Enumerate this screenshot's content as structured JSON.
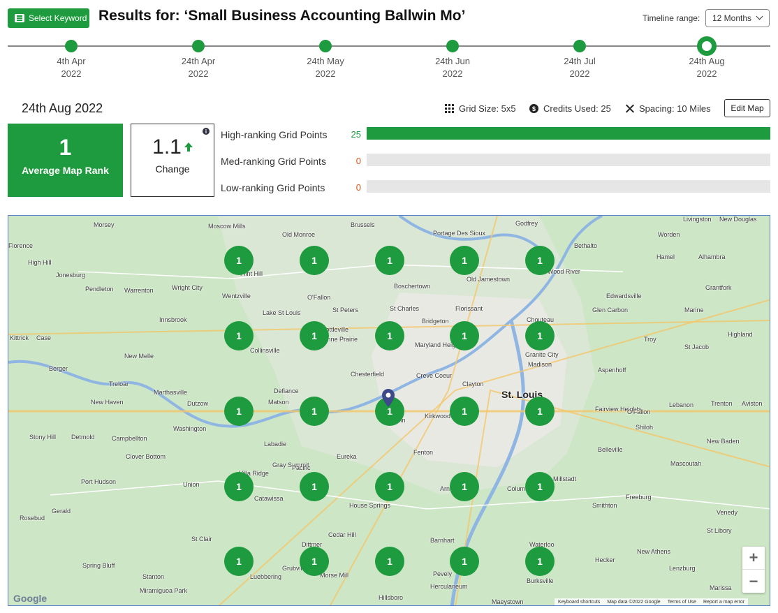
{
  "header": {
    "select_keyword_label": "Select Keyword",
    "title": "Results for: ‘Small Business Accounting Ballwin Mo’",
    "timeline_range_label": "Timeline range:",
    "timeline_range_value": "12 Months"
  },
  "timeline": [
    {
      "line1": "4th Apr",
      "line2": "2022"
    },
    {
      "line1": "24th Apr",
      "line2": "2022"
    },
    {
      "line1": "24th May",
      "line2": "2022"
    },
    {
      "line1": "24th Jun",
      "line2": "2022"
    },
    {
      "line1": "24th Jul",
      "line2": "2022"
    },
    {
      "line1": "24th Aug",
      "line2": "2022",
      "active": true
    }
  ],
  "summary": {
    "date": "24th Aug 2022",
    "grid_size": "Grid Size: 5x5",
    "credits_used": "Credits Used: 25",
    "spacing": "Spacing: 10 Miles",
    "edit_map_label": "Edit Map"
  },
  "stats": {
    "average_map_rank": "1",
    "average_map_rank_label": "Average Map Rank",
    "change_value": "1.1",
    "change_label": "Change",
    "change_direction_icon": "arrow-up-icon"
  },
  "rankings": [
    {
      "label": "High-ranking Grid Points",
      "count": "25",
      "color": "#1e9b3e",
      "fraction": 1.0
    },
    {
      "label": "Med-ranking Grid Points",
      "count": "0",
      "color": "#d9541e",
      "fraction": 0
    },
    {
      "label": "Low-ranking Grid Points",
      "count": "0",
      "color": "#d9541e",
      "fraction": 0
    }
  ],
  "map": {
    "grid_ranks": [
      [
        "1",
        "1",
        "1",
        "1",
        "1"
      ],
      [
        "1",
        "1",
        "1",
        "1",
        "1"
      ],
      [
        "1",
        "1",
        "1",
        "1",
        "1"
      ],
      [
        "1",
        "1",
        "1",
        "1",
        "1"
      ],
      [
        "1",
        "1",
        "1",
        "1",
        "1"
      ]
    ],
    "places": [
      "Morsey",
      "Moscow Mills",
      "Old Monroe",
      "Brussels",
      "Portage Des Sioux",
      "Godfrey",
      "Bethalto",
      "Livingston",
      "New Douglas",
      "Worden",
      "Florence",
      "High Hill",
      "Flint Hill",
      "Hamel",
      "Alhambra",
      "Jonesburg",
      "Wood River",
      "Old Jamestown",
      "Pendleton",
      "Warrenton",
      "Wright City",
      "Wentzville",
      "O'Fallon",
      "Boschertown",
      "Edwardsville",
      "Grantfork",
      "St Peters",
      "St Charles",
      "Florissant",
      "Innsbrook",
      "Lake St Louis",
      "Marine",
      "Glen Carbon",
      "Chouteau",
      "Highland",
      "Kittrick",
      "Case",
      "Bridgeton",
      "Cottleville",
      "Troy",
      "St Jacob",
      "Maryland Heights",
      "Dardenne Prairie",
      "Granite City",
      "Madison",
      "Aspenhoff",
      "New Melle",
      "Collinsville",
      "Berger",
      "Chesterfield",
      "Creve Coeur",
      "Treloar",
      "Clayton",
      "St. Louis",
      "Marthasville",
      "Defiance",
      "New Haven",
      "Dutzow",
      "Matson",
      "Fairview Heights",
      "O'Fallon",
      "Lebanon",
      "Trenton",
      "Aviston",
      "Ballwin",
      "Kirkwood",
      "Shiloh",
      "Stony Hill",
      "Detmold",
      "Campbellton",
      "Washington",
      "Labadie",
      "New Baden",
      "Clover Bottom",
      "Gray Summit",
      "Pacific",
      "Eureka",
      "Fenton",
      "Belleville",
      "Mascoutah",
      "Port Hudson",
      "Union",
      "Villa Ridge",
      "Millstadt",
      "Columbia",
      "Freeburg",
      "Rosebud",
      "Gerald",
      "Catawissa",
      "House Springs",
      "Arnold",
      "Smithton",
      "Venedy",
      "St Clair",
      "Cedar Hill",
      "Barnhart",
      "St Libory",
      "Spring Bluff",
      "Dittmer",
      "Waterloo",
      "New Athens",
      "Stanton",
      "Luebbering",
      "Grubville",
      "Morse Mill",
      "Hecker",
      "Lenzburg",
      "Miramiguoa Park",
      "Hillsboro",
      "Pevely",
      "Herculaneum",
      "Burksville",
      "Marissa",
      "Maeystown"
    ],
    "zoom_in_label": "+",
    "zoom_out_label": "−",
    "google_label": "Google",
    "attribution": [
      "Keyboard shortcuts",
      "Map data ©2022 Google",
      "Terms of Use",
      "Report a map error"
    ]
  }
}
